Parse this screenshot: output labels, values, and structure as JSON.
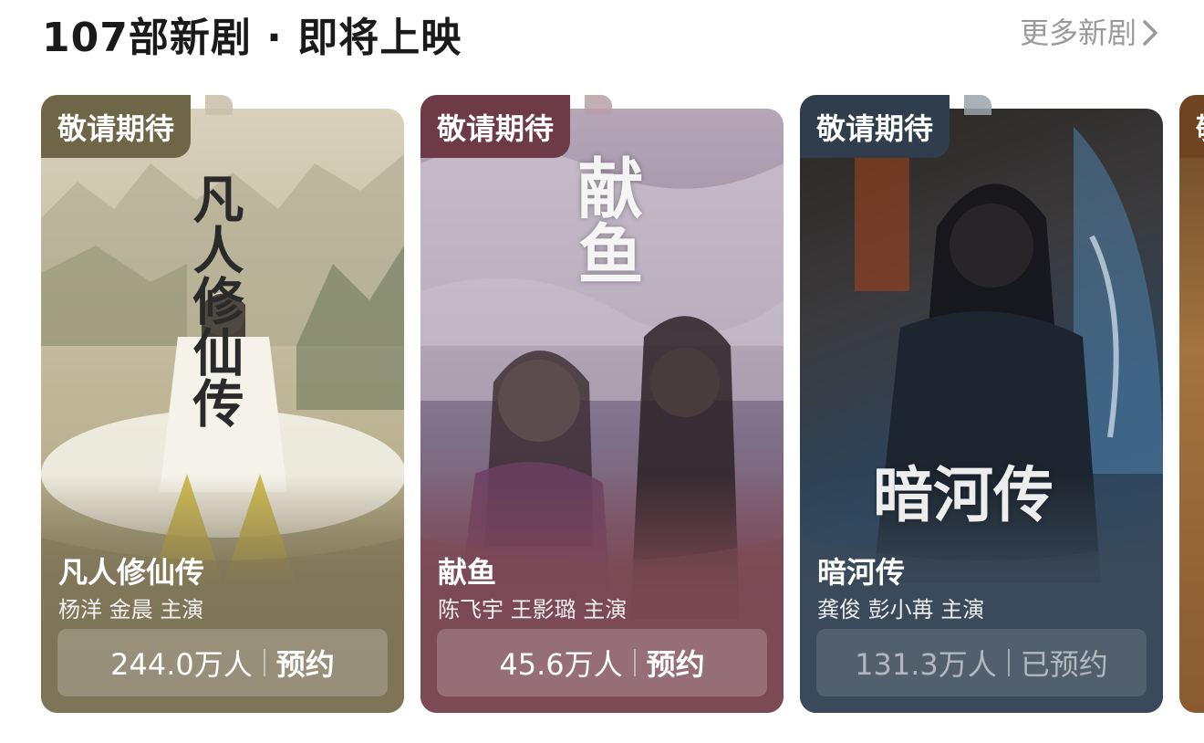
{
  "header": {
    "title": "107部新剧 · 即将上映",
    "more_label": "更多新剧"
  },
  "cards": [
    {
      "badge": "敬请期待",
      "poster_text": "凡人修仙传",
      "title": "凡人修仙传",
      "cast": "杨洋 金晨 主演",
      "count": "244.0万人",
      "action": "预约",
      "reserved": false,
      "color": "#7e7458"
    },
    {
      "badge": "敬请期待",
      "poster_text": "献鱼",
      "title": "献鱼",
      "cast": "陈飞宇 王影璐 主演",
      "count": "45.6万人",
      "action": "预约",
      "reserved": false,
      "color": "#7c4a55"
    },
    {
      "badge": "敬请期待",
      "poster_text": "暗河传",
      "title": "暗河传",
      "cast": "龚俊 彭小苒 主演",
      "count": "131.3万人",
      "action": "已预约",
      "reserved": true,
      "color": "#3b4a5a"
    },
    {
      "badge": "敬请期待",
      "color": "#8a5a32"
    }
  ]
}
